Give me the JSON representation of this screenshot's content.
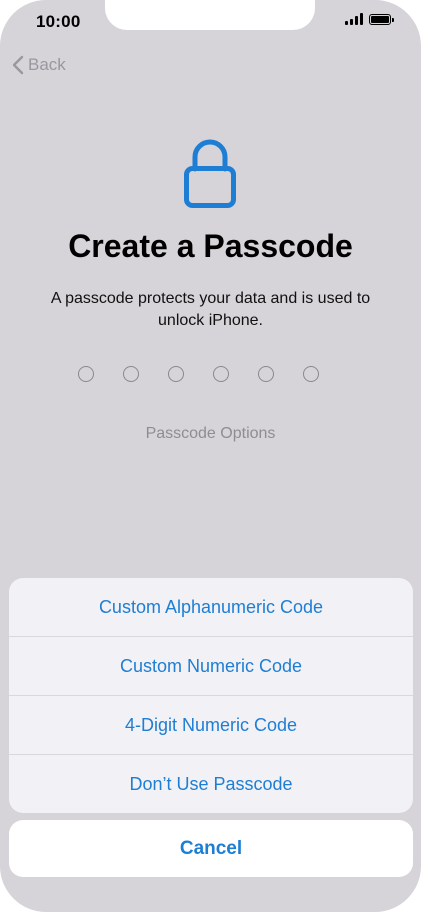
{
  "status_bar": {
    "time": "10:00"
  },
  "nav": {
    "back_label": "Back"
  },
  "header": {
    "icon": "lock-icon",
    "title": "Create a Passcode",
    "subtitle": "A passcode protects your data and is used to unlock iPhone."
  },
  "passcode": {
    "digit_count": 6,
    "options_label": "Passcode Options"
  },
  "action_sheet": {
    "items": [
      {
        "label": "Custom Alphanumeric Code"
      },
      {
        "label": "Custom Numeric Code"
      },
      {
        "label": "4-Digit Numeric Code"
      },
      {
        "label": "Don’t Use Passcode"
      }
    ],
    "cancel_label": "Cancel"
  },
  "colors": {
    "accent": "#1e7ed4",
    "background": "#d6d3d9",
    "sheet": "#f2f1f5",
    "muted_text": "#8f8c93"
  }
}
